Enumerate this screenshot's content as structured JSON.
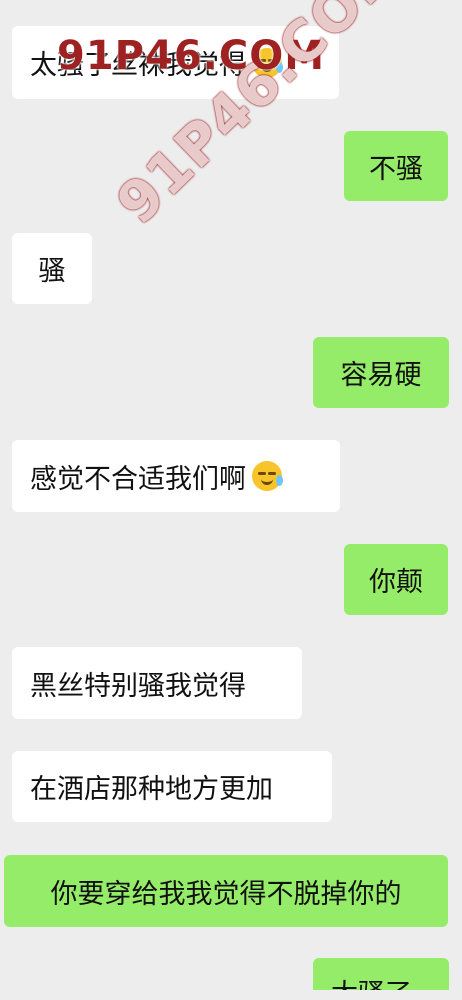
{
  "messages": [
    {
      "side": "in",
      "text": "太骚了丝袜我觉得",
      "emoji": "crying-face-emoji"
    },
    {
      "side": "out",
      "text": "不骚"
    },
    {
      "side": "in",
      "text": "骚"
    },
    {
      "side": "out",
      "text": "容易硬"
    },
    {
      "side": "in",
      "text": "感觉不合适我们啊",
      "emoji": "laughing-crying-face-emoji"
    },
    {
      "side": "out",
      "text": "你颠"
    },
    {
      "side": "in",
      "text": "黑丝特别骚我觉得"
    },
    {
      "side": "in",
      "text": "在酒店那种地方更加"
    },
    {
      "side": "out",
      "text": "你要穿给我我觉得不脱掉你的"
    },
    {
      "side": "out",
      "text": "太骚了"
    }
  ],
  "watermark": {
    "text": "91P46.COM"
  },
  "colors": {
    "background": "#ededed",
    "incoming_bubble": "#ffffff",
    "outgoing_bubble": "#95ec69"
  }
}
